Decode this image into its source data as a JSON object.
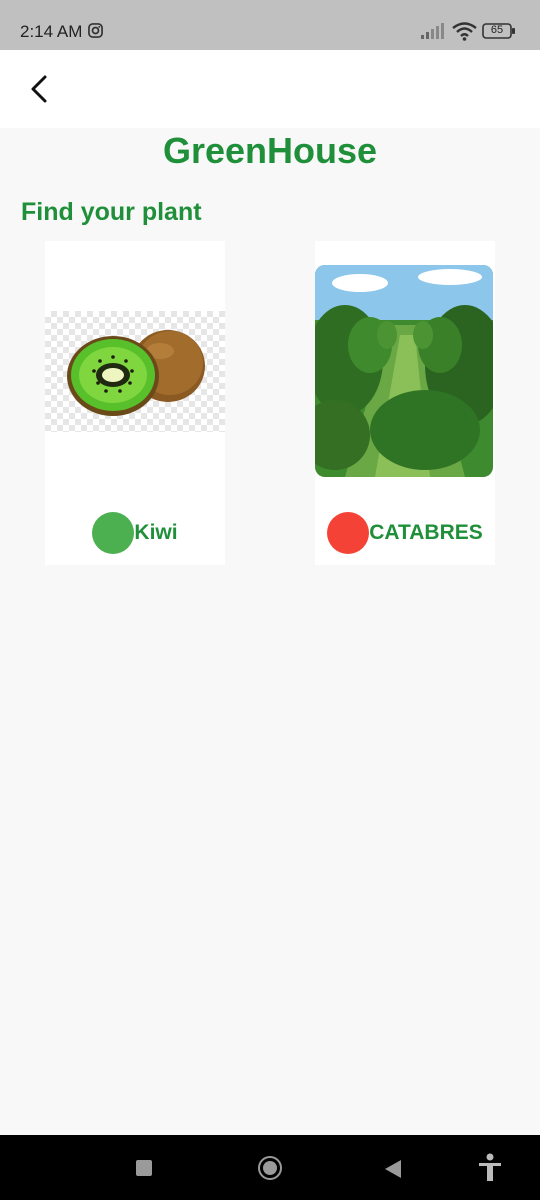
{
  "status_bar": {
    "time": "2:14 AM",
    "battery": "65",
    "icons": [
      "instagram-icon",
      "signal-icon",
      "wifi-icon",
      "battery-icon"
    ]
  },
  "app_bar": {
    "back_icon": "chevron-left-icon"
  },
  "page": {
    "title": "GreenHouse",
    "subtitle": "Find your plant"
  },
  "plants": [
    {
      "name": "Kiwi",
      "status_color": "#4caf50",
      "image": "kiwi-fruit-image"
    },
    {
      "name": "CATABRES",
      "status_color": "#f44336",
      "image": "orchard-image"
    }
  ],
  "colors": {
    "accent": "#1f8f3a",
    "status_bar": "#c0c0c0",
    "background": "#f8f8f8"
  },
  "nav_bar": {
    "icons": [
      "recents-icon",
      "home-icon",
      "back-icon",
      "accessibility-icon"
    ]
  }
}
